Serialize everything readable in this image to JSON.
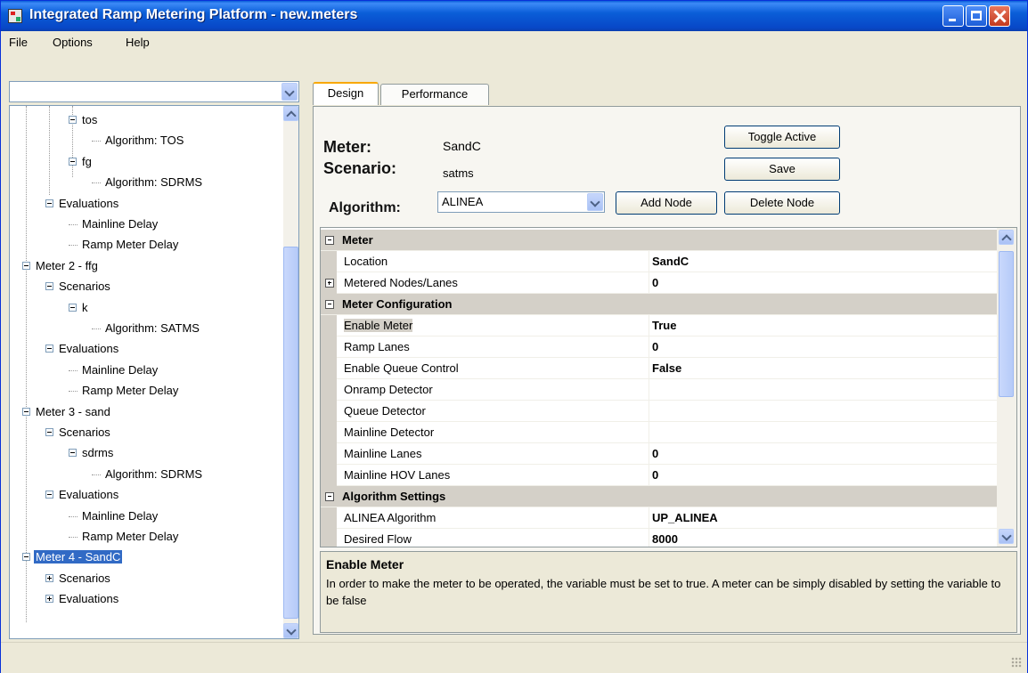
{
  "window": {
    "title": "Integrated Ramp Metering Platform - new.meters"
  },
  "menu": [
    "File",
    "Options",
    "Help"
  ],
  "tree": {
    "combo_value": "",
    "nodes": [
      {
        "label": "tos",
        "level": 3,
        "expander": "minus"
      },
      {
        "label": "Algorithm: TOS",
        "level": 4
      },
      {
        "label": "fg",
        "level": 3,
        "expander": "minus"
      },
      {
        "label": "Algorithm: SDRMS",
        "level": 4
      },
      {
        "label": "Evaluations",
        "level": 2,
        "expander": "minus"
      },
      {
        "label": "Mainline Delay",
        "level": 3
      },
      {
        "label": "Ramp Meter Delay",
        "level": 3
      },
      {
        "label": "Meter 2 - ffg",
        "level": 1,
        "expander": "minus"
      },
      {
        "label": "Scenarios",
        "level": 2,
        "expander": "minus"
      },
      {
        "label": "k",
        "level": 3,
        "expander": "minus"
      },
      {
        "label": "Algorithm: SATMS",
        "level": 4
      },
      {
        "label": "Evaluations",
        "level": 2,
        "expander": "minus"
      },
      {
        "label": "Mainline Delay",
        "level": 3
      },
      {
        "label": "Ramp Meter Delay",
        "level": 3
      },
      {
        "label": "Meter 3 - sand",
        "level": 1,
        "expander": "minus"
      },
      {
        "label": "Scenarios",
        "level": 2,
        "expander": "minus"
      },
      {
        "label": "sdrms",
        "level": 3,
        "expander": "minus"
      },
      {
        "label": "Algorithm: SDRMS",
        "level": 4
      },
      {
        "label": "Evaluations",
        "level": 2,
        "expander": "minus"
      },
      {
        "label": "Mainline Delay",
        "level": 3
      },
      {
        "label": "Ramp Meter Delay",
        "level": 3
      },
      {
        "label": "Meter 4 - SandC",
        "level": 1,
        "expander": "minus",
        "selected": true
      },
      {
        "label": "Scenarios",
        "level": 2,
        "expander": "plus"
      },
      {
        "label": "Evaluations",
        "level": 2,
        "expander": "plus"
      }
    ]
  },
  "tabs": [
    {
      "label": "Design",
      "active": true
    },
    {
      "label": "Performance",
      "active": false
    }
  ],
  "design": {
    "meter_label": "Meter:",
    "meter_value": "SandC",
    "scenario_label": "Scenario:",
    "scenario_value": "satms",
    "algorithm_label": "Algorithm:",
    "algorithm_value": "ALINEA",
    "toggle_active": "Toggle Active",
    "save": "Save",
    "add_node": "Add Node",
    "delete_node": "Delete Node"
  },
  "grid": {
    "rows": [
      {
        "type": "cat",
        "name": "Meter",
        "expander": "minus"
      },
      {
        "type": "prop",
        "name": "Location",
        "value": "SandC"
      },
      {
        "type": "prop",
        "name": "Metered Nodes/Lanes",
        "value": "0",
        "expander": "plus"
      },
      {
        "type": "cat",
        "name": "Meter Configuration",
        "expander": "minus"
      },
      {
        "type": "prop",
        "name": "Enable Meter",
        "value": "True",
        "selected": true
      },
      {
        "type": "prop",
        "name": "Ramp Lanes",
        "value": "0"
      },
      {
        "type": "prop",
        "name": "Enable Queue Control",
        "value": "False"
      },
      {
        "type": "prop",
        "name": "Onramp Detector",
        "value": ""
      },
      {
        "type": "prop",
        "name": "Queue Detector",
        "value": ""
      },
      {
        "type": "prop",
        "name": "Mainline Detector",
        "value": ""
      },
      {
        "type": "prop",
        "name": "Mainline Lanes",
        "value": "0"
      },
      {
        "type": "prop",
        "name": "Mainline HOV Lanes",
        "value": "0"
      },
      {
        "type": "cat",
        "name": "Algorithm Settings",
        "expander": "minus"
      },
      {
        "type": "prop",
        "name": "ALINEA Algorithm",
        "value": "UP_ALINEA"
      },
      {
        "type": "prop",
        "name": "Desired Flow",
        "value": "8000"
      }
    ]
  },
  "help": {
    "title": "Enable Meter",
    "description": "In order to make the meter to be operated, the variable must be set to true. A meter can be simply disabled by setting the variable to be false"
  }
}
